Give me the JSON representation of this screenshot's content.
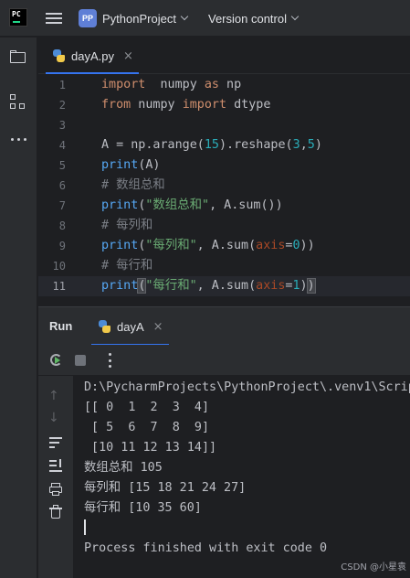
{
  "toolbar": {
    "logo_text": "PC",
    "project_badge": "PP",
    "project_name": "PythonProject",
    "vcs_label": "Version control"
  },
  "editor": {
    "tab": {
      "label": "dayA.py",
      "close": "×"
    },
    "lines": [
      {
        "n": "1",
        "tokens": [
          [
            "kw",
            "import"
          ],
          [
            "",
            "  numpy "
          ],
          [
            "kw",
            "as"
          ],
          [
            "",
            " np"
          ]
        ]
      },
      {
        "n": "2",
        "tokens": [
          [
            "kw",
            "from"
          ],
          [
            "",
            " numpy "
          ],
          [
            "kw",
            "import"
          ],
          [
            "",
            " dtype"
          ]
        ]
      },
      {
        "n": "3",
        "tokens": []
      },
      {
        "n": "4",
        "tokens": [
          [
            "",
            "A = np.arange("
          ],
          [
            "num",
            "15"
          ],
          [
            "",
            ").reshape("
          ],
          [
            "num",
            "3"
          ],
          [
            "",
            ","
          ],
          [
            "num",
            "5"
          ],
          [
            "",
            ")"
          ]
        ]
      },
      {
        "n": "5",
        "tokens": [
          [
            "fn",
            "print"
          ],
          [
            "",
            "(A)"
          ]
        ]
      },
      {
        "n": "6",
        "tokens": [
          [
            "cmt",
            "# 数组总和"
          ]
        ]
      },
      {
        "n": "7",
        "tokens": [
          [
            "fn",
            "print"
          ],
          [
            "",
            "("
          ],
          [
            "str",
            "\"数组总和\""
          ],
          [
            "",
            ", A.sum())"
          ]
        ]
      },
      {
        "n": "8",
        "tokens": [
          [
            "cmt",
            "# 每列和"
          ]
        ]
      },
      {
        "n": "9",
        "tokens": [
          [
            "fn",
            "print"
          ],
          [
            "",
            "("
          ],
          [
            "str",
            "\"每列和\""
          ],
          [
            "",
            ", A.sum("
          ],
          [
            "param",
            "axis"
          ],
          [
            "",
            "="
          ],
          [
            "num",
            "0"
          ],
          [
            "",
            "))"
          ]
        ]
      },
      {
        "n": "10",
        "tokens": [
          [
            "cmt",
            "# 每行和"
          ]
        ]
      },
      {
        "n": "11",
        "current": true,
        "tokens": [
          [
            "fn",
            "print"
          ],
          [
            "brk match",
            "("
          ],
          [
            "str",
            "\"每行和\""
          ],
          [
            "",
            ", A.sum("
          ],
          [
            "param",
            "axis"
          ],
          [
            "",
            "="
          ],
          [
            "num",
            "1"
          ],
          [
            "",
            ")"
          ],
          [
            "brk match",
            ")"
          ]
        ]
      }
    ]
  },
  "run": {
    "title": "Run",
    "tab_label": "dayA",
    "tab_close": "×",
    "output": [
      "D:\\PycharmProjects\\PythonProject\\.venv1\\Scripts\\python.exe",
      "[[ 0  1  2  3  4]",
      " [ 5  6  7  8  9]",
      " [10 11 12 13 14]]",
      "数组总和 105",
      "每列和 [15 18 21 24 27]",
      "每行和 [10 35 60]",
      "",
      "Process finished with exit code 0"
    ]
  },
  "watermark": "CSDN @小星袁",
  "colors": {
    "accent": "#3574f0",
    "keyword": "#cf8e6d",
    "function": "#56a8f5",
    "number": "#2aacb8",
    "string": "#6aab73",
    "comment": "#7a7e85",
    "parameter": "#aa4926"
  }
}
